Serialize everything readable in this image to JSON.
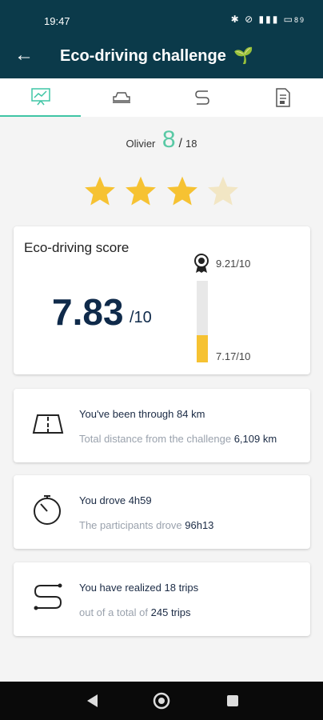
{
  "status_bar": {
    "time": "19:47",
    "battery": "89"
  },
  "app_bar": {
    "title": "Eco-driving challenge",
    "leaf_glyph": "🌱"
  },
  "tabs": [
    "statistics-chart-icon",
    "car-icon",
    "route-icon",
    "report-icon"
  ],
  "player": {
    "name": "Olivier",
    "rank": "8",
    "separator": "/",
    "total": "18"
  },
  "rating": {
    "filled": 3,
    "max": 4
  },
  "score": {
    "label": "Eco-driving score",
    "value": "7.83",
    "unit": "/10",
    "best": "9.21/10",
    "current": "7.17/10",
    "fill_fraction": 0.33
  },
  "distance": {
    "line1_prefix": "You've been through",
    "line1_value": "84 km",
    "line2_prefix": "Total distance from the challenge",
    "line2_value": "6,109 km"
  },
  "time": {
    "line1_prefix": "You drove",
    "line1_value": "4h59",
    "line2_prefix": "The participants drove",
    "line2_value": "96h13"
  },
  "trips": {
    "line1_prefix": "You have realized",
    "line1_value": "18 trips",
    "line2_prefix": "out of a total of",
    "line2_value": "245 trips"
  },
  "colors": {
    "header": "#0b3a4a",
    "accent": "#59c9a5",
    "star": "#f6c232",
    "star_empty": "#f2e6c4"
  }
}
